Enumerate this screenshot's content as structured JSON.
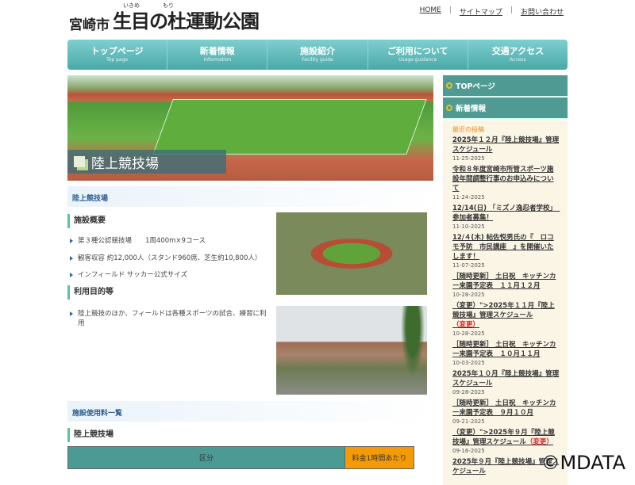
{
  "header": {
    "city": "宮崎市",
    "name": "生目の杜運動公園",
    "ruby1": "いきめ",
    "ruby2": "もり",
    "links": [
      "HOME",
      "サイトマップ",
      "お問い合わせ"
    ],
    "sep": "|"
  },
  "nav": [
    {
      "jp": "トップページ",
      "en": "Top page"
    },
    {
      "jp": "新着情報",
      "en": "Information"
    },
    {
      "jp": "施設紹介",
      "en": "Facility guide"
    },
    {
      "jp": "ご利用について",
      "en": "Usage guidance"
    },
    {
      "jp": "交通アクセス",
      "en": "Access"
    }
  ],
  "hero": {
    "label": "陸上競技場"
  },
  "section1": {
    "title": "陸上競技場",
    "overview": "施設概要",
    "bullets": [
      "第３種公認競技場　　1周400m×9コース",
      "観客収容 約12,000人（スタンド960席、芝生約10,800人）",
      "インフィールド サッカー公式サイズ"
    ],
    "purpose": "利用目的等",
    "purpose_bullet": "陸上競技のほか、フィールドは各種スポーツの試合、練習に利用"
  },
  "section2": {
    "title": "施設使用料一覧",
    "sub": "陸上競技場",
    "th1": "区分",
    "th2": "料金1時間あたり"
  },
  "sidebar": {
    "buttons": [
      "TOPページ",
      "新着情報"
    ],
    "recent": "最近の投稿",
    "news": [
      {
        "t": "2025年１２月『陸上競技場』管理スケジュール",
        "d": "11-25-2025"
      },
      {
        "t": "令和８年度宮崎市所管スポーツ施設年間調整行事のお申込みについて",
        "d": "11-24-2025"
      },
      {
        "t": "12/14(日) 「ミズノ逸忍者学校」　参加者募集！",
        "d": "11-10-2025"
      },
      {
        "t": "12/４(木) 帖佐悦男氏の『　ロコモ予防　市民講座　』を開催いたします！",
        "d": "11-07-2025"
      },
      {
        "t": "［随時更新］ 土日祝　キッチンカー来園予定表　１１月１２月",
        "d": "10-28-2025"
      },
      {
        "t": "（変更）\">2025年１１月『陸上競技場』管理スケジュール",
        "r": "（変更）",
        "d": "10-28-2025"
      },
      {
        "t": "［随時更新］ 土日祝　キッチンカー来園予定表　１０月１１月",
        "d": "10-03-2025"
      },
      {
        "t": "2025年１０月『陸上競技場』管理スケジュール",
        "d": "09-28-2025"
      },
      {
        "t": "［随時更新］ 土日祝　キッチンカー来園予定表　９月１０月",
        "d": "09-21-2025"
      },
      {
        "t": "（変更）\">2025年９月『陸上競技場』管理スケジュール",
        "r": "（変更）",
        "d": "09-16-2025"
      },
      {
        "t": "2025年９月『陸上競技場』管理スケジュール",
        "d": ""
      }
    ]
  },
  "watermark": "©MDATA"
}
